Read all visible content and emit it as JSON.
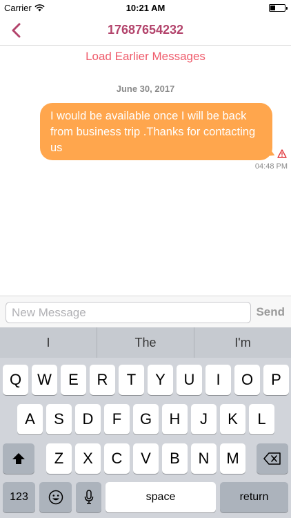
{
  "status": {
    "carrier": "Carrier",
    "time": "10:21 AM",
    "battery_level": 0.35
  },
  "nav": {
    "title": "17687654232"
  },
  "chat": {
    "load_earlier": "Load Earlier Messages",
    "date": "June 30, 2017",
    "messages": [
      {
        "text": "I would be available once I will be back from business trip .Thanks for contacting us",
        "time": "04:48 PM"
      }
    ]
  },
  "input": {
    "placeholder": "New Message",
    "send_label": "Send"
  },
  "keyboard": {
    "suggestions": [
      "I",
      "The",
      "I'm"
    ],
    "row1": [
      "Q",
      "W",
      "E",
      "R",
      "T",
      "Y",
      "U",
      "I",
      "O",
      "P"
    ],
    "row2": [
      "A",
      "S",
      "D",
      "F",
      "G",
      "H",
      "J",
      "K",
      "L"
    ],
    "row3": [
      "Z",
      "X",
      "C",
      "V",
      "B",
      "N",
      "M"
    ],
    "numbers_label": "123",
    "space_label": "space",
    "return_label": "return"
  },
  "colors": {
    "accent": "#b3446c",
    "bubble": "#ffa64d",
    "link": "#ef5b6b"
  }
}
